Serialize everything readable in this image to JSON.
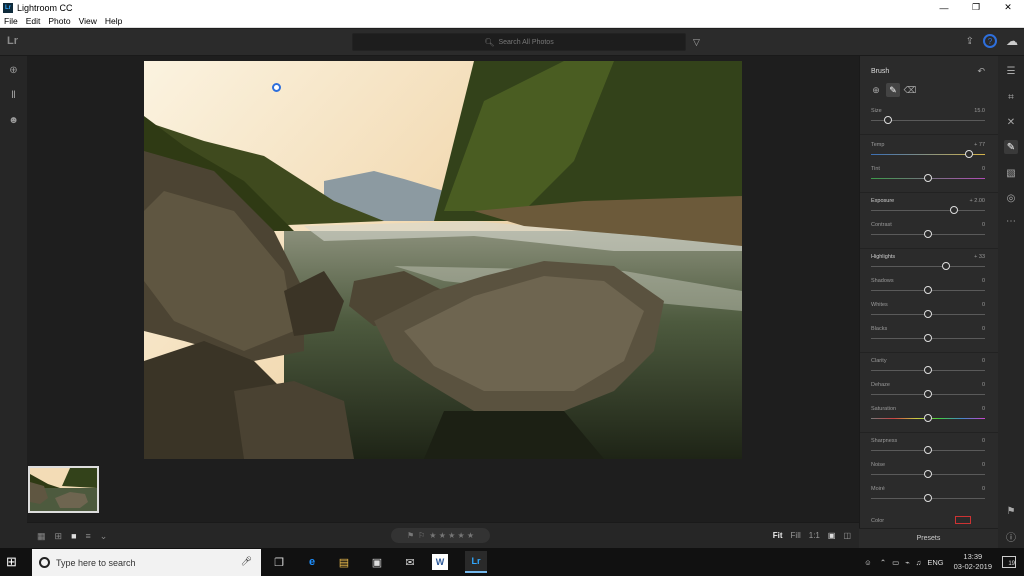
{
  "window": {
    "app_icon_label": "Lr",
    "title": "Lightroom CC",
    "controls": [
      "—",
      "❐",
      "✕"
    ]
  },
  "menu": [
    "File",
    "Edit",
    "Photo",
    "View",
    "Help"
  ],
  "toolbar": {
    "logo": "Lr",
    "search_placeholder": "Search All Photos",
    "help_label": "?"
  },
  "panel": {
    "title": "Brush",
    "sliders": [
      {
        "label": "Size",
        "value": "15.0",
        "pos": 0.15
      },
      {
        "label": "Temp",
        "value": "+ 77",
        "pos": 0.86
      },
      {
        "label": "Tint",
        "value": "0",
        "pos": 0.5
      },
      {
        "label": "Exposure",
        "value": "+ 2.00",
        "pos": 0.73
      },
      {
        "label": "Contrast",
        "value": "0",
        "pos": 0.5
      },
      {
        "label": "Highlights",
        "value": "+ 33",
        "pos": 0.66
      },
      {
        "label": "Shadows",
        "value": "0",
        "pos": 0.5
      },
      {
        "label": "Whites",
        "value": "0",
        "pos": 0.5
      },
      {
        "label": "Blacks",
        "value": "0",
        "pos": 0.5
      },
      {
        "label": "Clarity",
        "value": "0",
        "pos": 0.5
      },
      {
        "label": "Dehaze",
        "value": "0",
        "pos": 0.5
      },
      {
        "label": "Saturation",
        "value": "0",
        "pos": 0.5
      },
      {
        "label": "Sharpness",
        "value": "0",
        "pos": 0.5
      },
      {
        "label": "Noise",
        "value": "0",
        "pos": 0.5
      },
      {
        "label": "Moiré",
        "value": "0",
        "pos": 0.5
      }
    ],
    "color_label": "Color",
    "presets_label": "Presets"
  },
  "bottombar": {
    "fit": "Fit",
    "fill": "Fill",
    "one_to_one": "1:1",
    "stars": "★ ★ ★ ★ ★"
  },
  "taskbar": {
    "search_placeholder": "Type here to search",
    "language": "ENG",
    "time": "13:39",
    "date": "03-02-2019",
    "notification_count": "19"
  },
  "colors": {
    "accent": "#2e6fdc",
    "panel_bg": "#2b2b2b",
    "canvas_bg": "#1e1e1e"
  }
}
